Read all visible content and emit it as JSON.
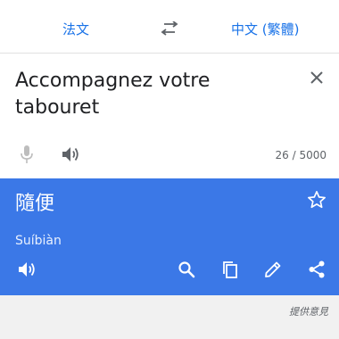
{
  "languages": {
    "source": "法文",
    "target": "中文 (繁體)"
  },
  "input": {
    "text": "Accompagnez votre tabouret",
    "char_count": "26 / 5000"
  },
  "result": {
    "text": "隨便",
    "transliteration": "Suíbiàn"
  },
  "footer": {
    "feedback": "提供意見"
  },
  "colors": {
    "accent": "#1a73e8",
    "result_bg": "#3b78e7",
    "background": "#f1f1f1"
  },
  "icons": {
    "swap": "swap-arrows-icon",
    "clear": "close-icon",
    "mic": "mic-icon",
    "speak": "volume-icon",
    "star": "star-outline-icon",
    "search": "search-icon",
    "copy": "copy-icon",
    "edit": "pencil-icon",
    "share": "share-icon"
  }
}
